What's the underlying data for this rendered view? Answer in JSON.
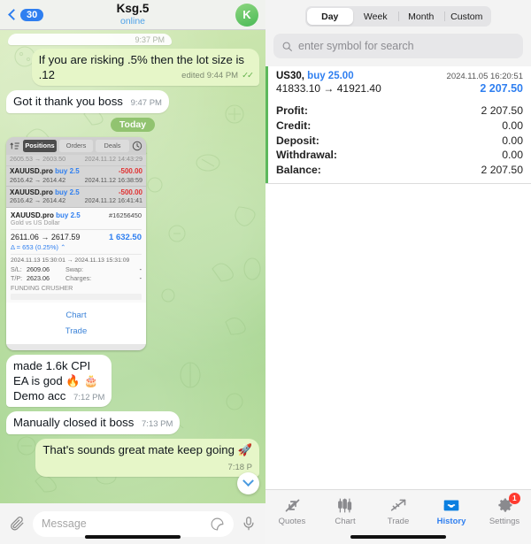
{
  "telegram": {
    "header": {
      "back_badge": "30",
      "title": "Ksg.5",
      "status": "online",
      "avatar_letter": "K"
    },
    "cut_bubble_time": "9:37 PM",
    "messages": [
      {
        "dir": "out",
        "text": "If you are risking .5% then the lot size is .12",
        "time": "edited 9:44 PM",
        "ticks": "✓✓"
      },
      {
        "dir": "in",
        "text": "Got it thank you boss",
        "time": "9:47 PM"
      }
    ],
    "day_divider": "Today",
    "attachment": {
      "toolbar": {
        "sort_icon": "sort-icon",
        "tabs": [
          "Positions",
          "Orders",
          "Deals"
        ],
        "active_tab": "Positions",
        "clock_icon": "clock-icon"
      },
      "partial_row": {
        "prices": "2605.53 → 2603.50",
        "datetime": "2024.11.12 14:43:29"
      },
      "rows": [
        {
          "symbol": "XAUUSD.pro",
          "side": "buy 2.5",
          "amount": "-500.00",
          "prices": "2616.42 → 2614.42",
          "datetime": "2024.11.12 16:38:59"
        },
        {
          "symbol": "XAUUSD.pro",
          "side": "buy 2.5",
          "amount": "-500.00",
          "prices": "2616.42 → 2614.42",
          "datetime": "2024.11.12 16:41:41"
        }
      ],
      "detail": {
        "symbol": "XAUUSD.pro",
        "side": "buy 2.5",
        "ticket": "#16256450",
        "description": "Gold vs US Dollar",
        "prices": "2611.06 → 2617.59",
        "profit": "1 632.50",
        "delta": "Δ = 653 (0.25%) ⌃",
        "dates": "2024.11.13 15:30:01 → 2024.11.13 15:31:09",
        "sl_label": "S/L:",
        "sl_value": "2609.06",
        "swap_label": "Swap:",
        "swap_value": "-",
        "tp_label": "T/P:",
        "tp_value": "2623.06",
        "charges_label": "Charges:",
        "charges_value": "-",
        "comment": "FUNDING CRUSHER"
      },
      "actions": [
        "Chart",
        "Trade"
      ]
    },
    "messages_after": [
      {
        "dir": "in",
        "lines": [
          "made 1.6k CPI",
          "EA is god 🔥 🎂",
          "Demo acc"
        ],
        "time": "7:12 PM"
      },
      {
        "dir": "in",
        "text": "Manually closed it boss",
        "time": "7:13 PM"
      },
      {
        "dir": "out",
        "text": "That's sounds great mate keep going 🚀",
        "time": "7:18 P"
      }
    ],
    "scroll_down_icon": "chevron-down-icon",
    "input": {
      "attach_icon": "paperclip-icon",
      "placeholder": "Message",
      "sticker_icon": "sticker-icon",
      "mic_icon": "microphone-icon"
    }
  },
  "metatrader": {
    "period_tabs": [
      "Day",
      "Week",
      "Month",
      "Custom"
    ],
    "active_period": "Day",
    "search": {
      "icon": "search-icon",
      "placeholder": "enter symbol for search"
    },
    "deal": {
      "symbol": "US30,",
      "side": "buy 25.00",
      "datetime": "2024.11.05 16:20:51",
      "prices": "41833.10 → 41921.40",
      "amount": "2 207.50",
      "accent_color": "#5cb85c"
    },
    "summary": [
      {
        "label": "Profit:",
        "value": "2 207.50"
      },
      {
        "label": "Credit:",
        "value": "0.00"
      },
      {
        "label": "Deposit:",
        "value": "0.00"
      },
      {
        "label": "Withdrawal:",
        "value": "0.00"
      },
      {
        "label": "Balance:",
        "value": "2 207.50"
      }
    ],
    "tabs": [
      {
        "label": "Quotes",
        "icon": "quotes-arrows-icon",
        "active": false
      },
      {
        "label": "Chart",
        "icon": "candlestick-icon",
        "active": false
      },
      {
        "label": "Trade",
        "icon": "trend-arrow-icon",
        "active": false
      },
      {
        "label": "History",
        "icon": "inbox-icon",
        "active": true
      },
      {
        "label": "Settings",
        "icon": "gear-icon",
        "active": false,
        "badge": "1"
      }
    ],
    "accent_blue": "#2f7ff0"
  }
}
